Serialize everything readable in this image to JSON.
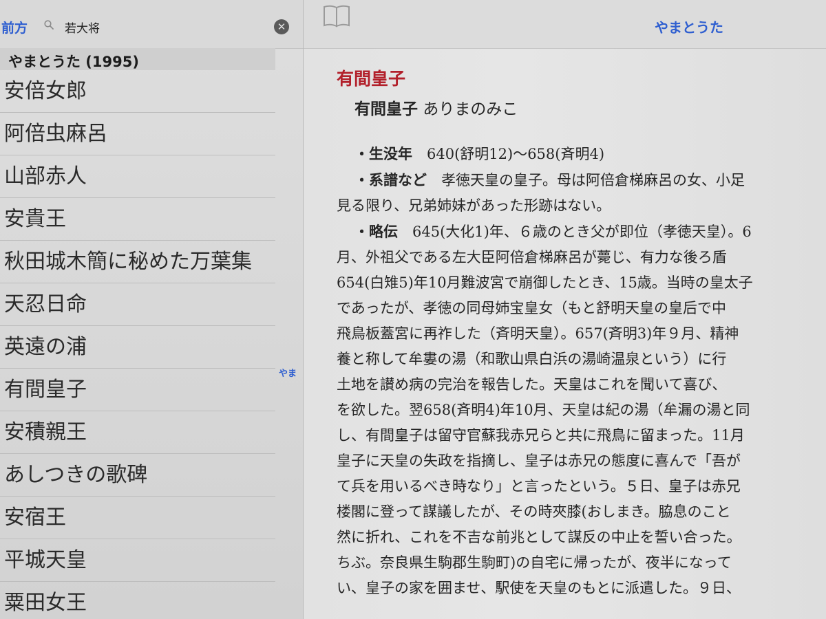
{
  "search": {
    "back_label": "前方",
    "query": "若大将",
    "clear_symbol": "✕"
  },
  "results": {
    "section_header": "やまとうた (1995)",
    "items": [
      "安倍女郎",
      "阿倍虫麻呂",
      "山部赤人",
      "安貴王",
      "秋田城木簡に秘めた万葉集",
      "天忍日命",
      "英遠の浦",
      "有間皇子",
      "安積親王",
      "あしつきの歌碑",
      "安宿王",
      "平城天皇",
      "粟田女王"
    ],
    "index_label": "やま"
  },
  "nav": {
    "title": "やまとうた"
  },
  "entry": {
    "heading": "有間皇子",
    "name": "有間皇子",
    "reading": "ありまのみこ",
    "lines": [
      {
        "label": "・生没年",
        "text": "　640(舒明12)〜658(斉明4)"
      },
      {
        "label": "・系譜など",
        "text": "　孝徳天皇の皇子。母は阿倍倉梯麻呂の女、小足"
      },
      {
        "label": "",
        "text": "見る限り、兄弟姉妹があった形跡はない。"
      },
      {
        "label": "・略伝",
        "text": "　645(大化1)年、６歳のとき父が即位（孝徳天皇）。6"
      },
      {
        "label": "",
        "text": "月、外祖父である左大臣阿倍倉梯麻呂が薨じ、有力な後ろ盾"
      },
      {
        "label": "",
        "text": "654(白雉5)年10月難波宮で崩御したとき、15歳。当時の皇太子"
      },
      {
        "label": "",
        "text": "であったが、孝徳の同母姉宝皇女（もと舒明天皇の皇后で中"
      },
      {
        "label": "",
        "text": "飛鳥板蓋宮に再祚した（斉明天皇）。657(斉明3)年９月、精神"
      },
      {
        "label": "",
        "text": "養と称して牟婁の湯（和歌山県白浜の湯崎温泉という）に行"
      },
      {
        "label": "",
        "text": "土地を讃め病の完治を報告した。天皇はこれを聞いて喜び、"
      },
      {
        "label": "",
        "text": "を欲した。翌658(斉明4)年10月、天皇は紀の湯（牟漏の湯と同"
      },
      {
        "label": "",
        "text": "し、有間皇子は留守官蘇我赤兄らと共に飛鳥に留まった。11月"
      },
      {
        "label": "",
        "text": "皇子に天皇の失政を指摘し、皇子は赤兄の態度に喜んで「吾が"
      },
      {
        "label": "",
        "text": "て兵を用いるべき時なり」と言ったという。５日、皇子は赤兄"
      },
      {
        "label": "",
        "text": "楼閣に登って謀議したが、その時夾膝(おしまき。脇息のこと"
      },
      {
        "label": "",
        "text": "然に折れ、これを不吉な前兆として謀反の中止を誓い合った。"
      },
      {
        "label": "",
        "text": "ちぶ。奈良県生駒郡生駒町)の自宅に帰ったが、夜半になって"
      },
      {
        "label": "",
        "text": "い、皇子の家を囲ませ、駅使を天皇のもとに派遣した。９日、"
      }
    ]
  }
}
